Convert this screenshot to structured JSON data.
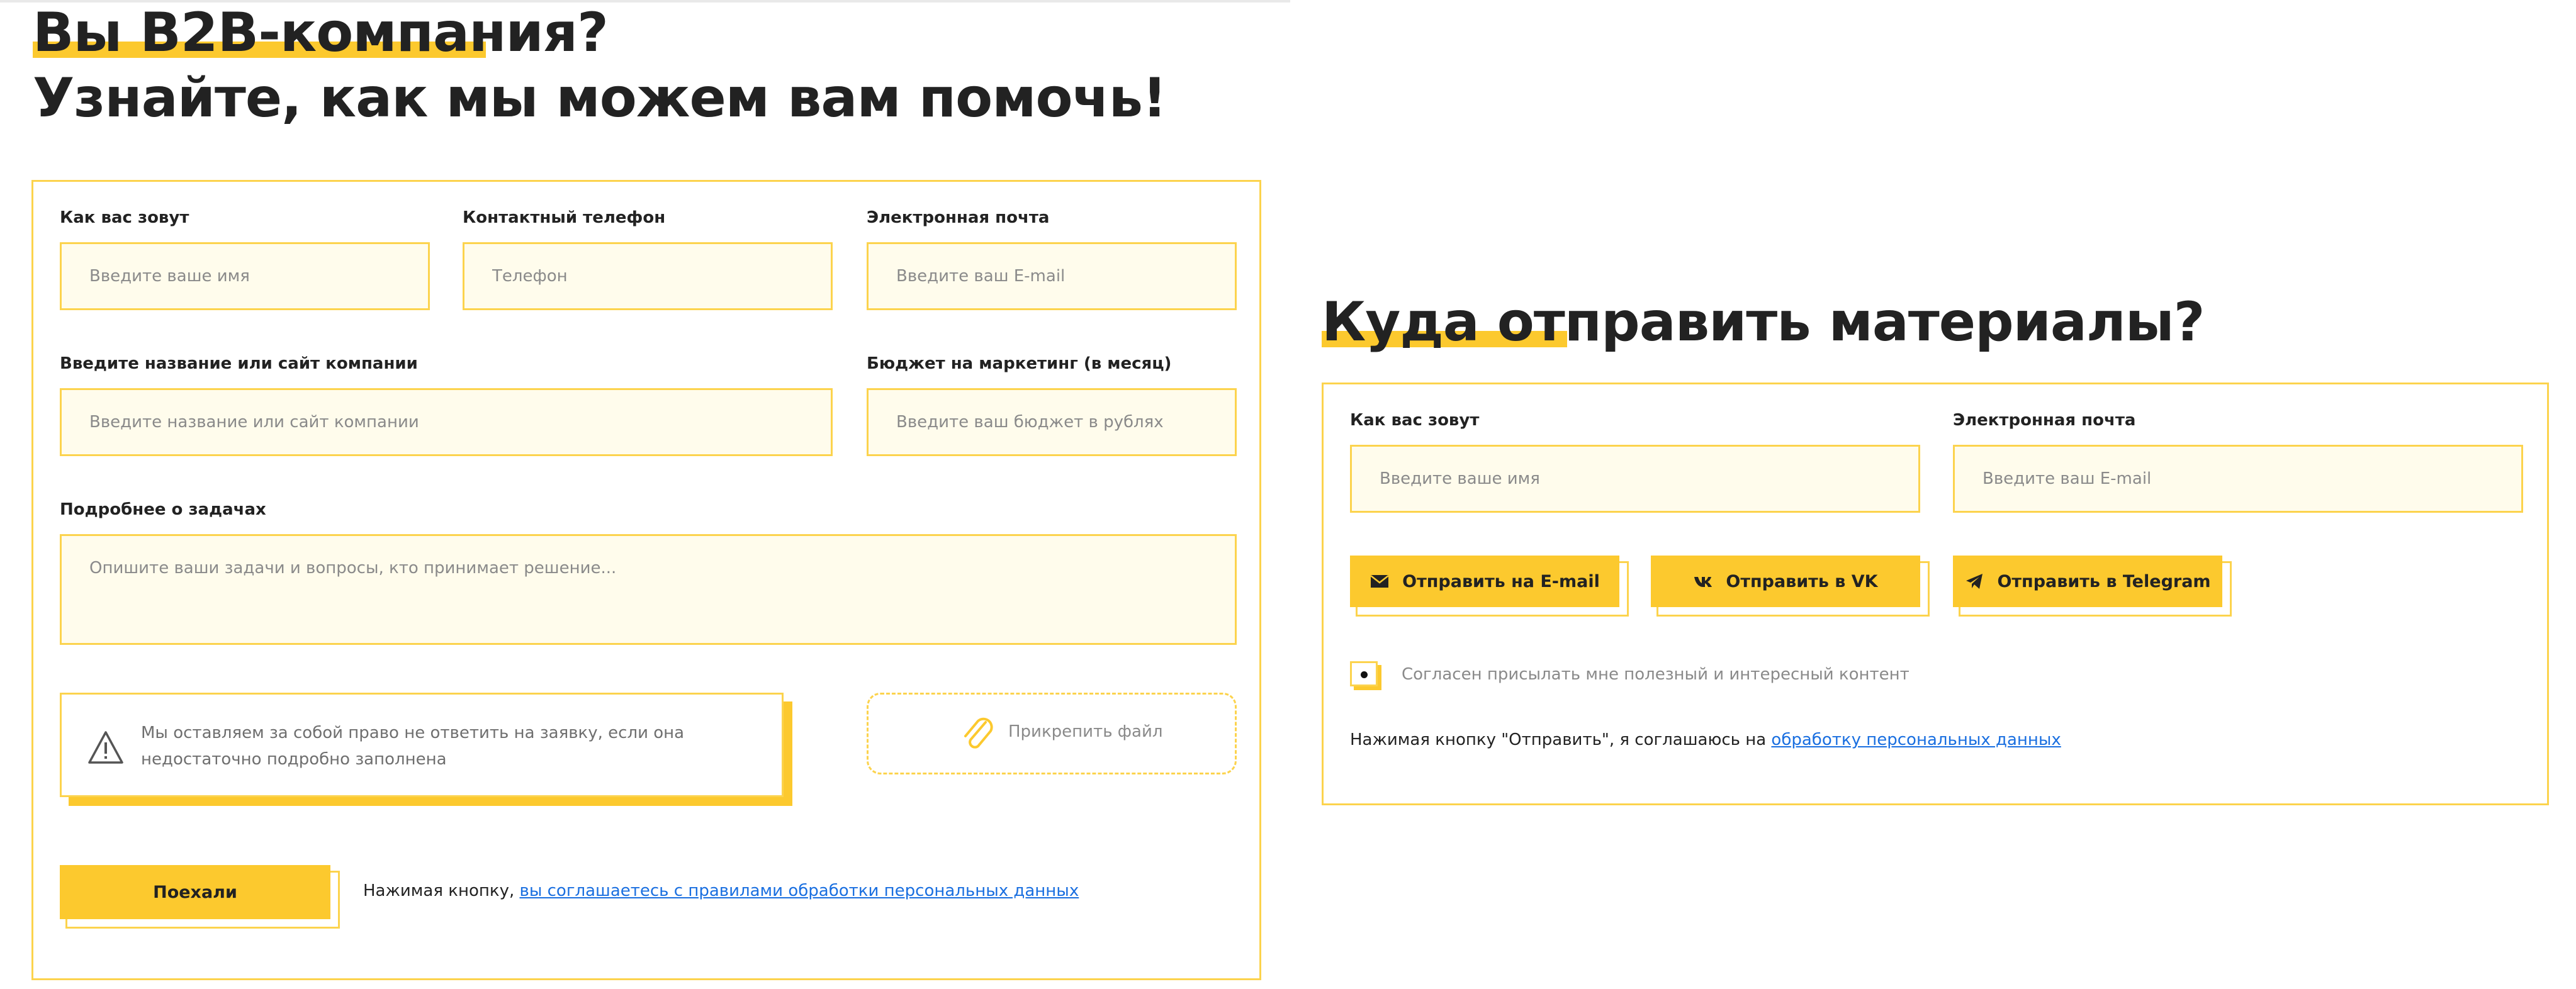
{
  "left_section": {
    "title_line1": "Вы B2B-компания?",
    "title_line2": "Узнайте, как мы можем вам помочь!",
    "fields": {
      "name": {
        "label": "Как вас зовут",
        "placeholder": "Введите ваше имя"
      },
      "phone": {
        "label": "Контактный телефон",
        "placeholder": "Телефон"
      },
      "email": {
        "label": "Электронная почта",
        "placeholder": "Введите ваш E-mail"
      },
      "company": {
        "label": "Введите название или сайт компании",
        "placeholder": "Введите название или сайт компании"
      },
      "budget": {
        "label": "Бюджет на маркетинг (в месяц)",
        "placeholder": "Введите ваш бюджет в рублях"
      },
      "details": {
        "label": "Подробнее о задачах",
        "placeholder": "Опишите ваши задачи и вопросы, кто принимает решение..."
      }
    },
    "notice": "Мы оставляем за собой право не ответить на заявку, если она недостаточно подробно заполнена",
    "attach_label": "Прикрепить файл",
    "submit_label": "Поехали",
    "consent_prefix": "Нажимая кнопку, ",
    "consent_link": "вы соглашаетесь с правилами обработки персональных данных"
  },
  "right_section": {
    "title": "Куда отправить материалы?",
    "fields": {
      "name": {
        "label": "Как вас зовут",
        "placeholder": "Введите ваше имя"
      },
      "email": {
        "label": "Электронная почта",
        "placeholder": "Введите ваш E-mail"
      }
    },
    "buttons": {
      "email": "Отправить на E-mail",
      "vk": "Отправить в VK",
      "telegram": "Отправить в Telegram"
    },
    "checkbox_label": "Согласен присылать мне полезный и интересный контент",
    "checkbox_checked": true,
    "consent_prefix": "Нажимая кнопку \"Отправить\", я соглашаюсь на ",
    "consent_link": "обработку персональных данных"
  },
  "colors": {
    "accent": "#fcc92e",
    "border": "#fcd34d",
    "input_bg": "#fffcec",
    "link": "#1a6fe0"
  },
  "icons": [
    "warning-icon",
    "paperclip-icon",
    "envelope-icon",
    "vk-icon",
    "telegram-icon"
  ]
}
